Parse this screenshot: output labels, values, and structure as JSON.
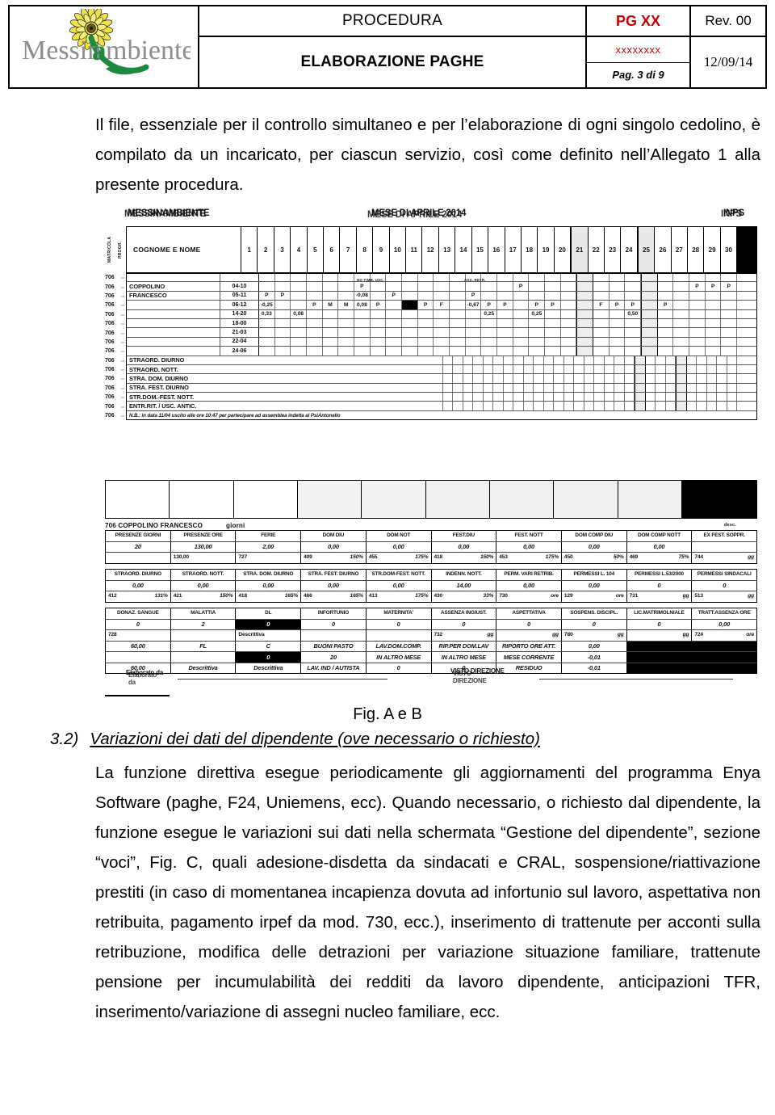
{
  "header": {
    "logo_text": "Messinambiente",
    "logo_icon": "sunflower-logo",
    "procedura_label": "PROCEDURA",
    "doc_code": "PG XX",
    "revision": "Rev. 00",
    "doc_title": "ELABORAZIONE PAGHE",
    "doc_number": "xxxxxxxx",
    "page_label": "Pag. 3 di 9",
    "date": "12/09/14",
    "accent_color": "#cc0000"
  },
  "intro_paragraph": "Il file, essenziale per il controllo simultaneo e per l’elaborazione di ogni singolo cedolino, è compilato da un incaricato, per ciascun servizio, così come definito nell’Allegato 1 alla presente procedura.",
  "figure_caption": "Fig. A e B",
  "section": {
    "number": "3.2)",
    "title": "Variazioni dei dati del dipendente (ove necessario o richiesto)",
    "body": "La funzione direttiva esegue periodicamente gli aggiornamenti del programma Enya Software (paghe, F24, Uniemens, ecc). Quando necessario, o richiesto dal dipendente, la funzione esegue le variazioni sui dati nella schermata “Gestione del dipendente”, sezione “voci”, Fig. C, quali adesione-disdetta da sindacati e CRAL, sospensione/riattivazione prestiti (in caso di momentanea incapienza dovuta ad infortunio sul lavoro, aspettativa non retribuita, pagamento irpef da mod. 730, ecc.), inserimento di trattenute per acconti sulla retribuzione, modifica delle detrazioni per variazione situazione familiare, trattenute pensione per incumulabilità dei redditi da lavoro dipendente, anticipazioni TFR, inserimento/variazione di assegni nucleo familiare, ecc."
  },
  "scan": {
    "company": "MESSINAMBIENTE",
    "period": "MESE DI APRILE 2014",
    "institute": "INPS",
    "col_matricola": "MATRICOLA",
    "col_progr": "PROGR.",
    "name_header": "COGNOME E NOME",
    "days": [
      "1",
      "2",
      "3",
      "4",
      "5",
      "6",
      "7",
      "8",
      "9",
      "10",
      "11",
      "12",
      "13",
      "14",
      "15",
      "16",
      "17",
      "18",
      "19",
      "20",
      "21",
      "22",
      "23",
      "24",
      "25",
      "26",
      "27",
      "28",
      "29",
      "30"
    ],
    "shaded_days": [
      "21",
      "25"
    ],
    "micro_labels": [
      "NO TIMB. USC.",
      "ASS. RETR."
    ],
    "matricola": "706",
    "employee_surname": "COPPOLINO",
    "employee_firstname": "FRANCESCO",
    "shift_codes": [
      "04-10",
      "05-11",
      "06-12",
      "14-20",
      "18-00",
      "21-03",
      "22-04",
      "24-06"
    ],
    "overtime_labels": [
      "STRAORD. DIURNO",
      "STRAORD. NOTT.",
      "STRA. DOM. DIURNO",
      "STRA. FEST. DIURNO",
      "STR.DOM.-FEST. NOTT.",
      "ENTR.RIT. / USC. ANTIC."
    ],
    "note": "N.B.: in data 11/04 uscito alle ore 10:47 per partecipare ad assemblea indetta al PsiAntonello",
    "marks": {
      "row_0410": {
        "7": "P",
        "17": "P",
        "28": "P",
        "29": "P",
        "30": "P"
      },
      "row_0511": {
        "1": "P",
        "2": "P",
        "7": "-0,08",
        "9": "P",
        "14": "P"
      },
      "row_0612": {
        "1": "-0,25",
        "4": "P",
        "5": "M",
        "6": "M",
        "7": "0,08",
        "8": "P",
        "11": "P",
        "12": "F",
        "14": "-0,67",
        "15": "P",
        "16": "P",
        "18": "P",
        "19": "P",
        "22": "F",
        "23": "P",
        "24": "P",
        "26": "P"
      },
      "row_1420": {
        "1": "0,33",
        "3": "0,08",
        "15": "0,25",
        "18": "0,25",
        "24": "0,50"
      }
    },
    "summary_title": {
      "matricola_name": "706 COPPOLINO FRANCESCO",
      "giorni": "giorni",
      "desc": "desc."
    },
    "table1": {
      "headers": [
        "PRESENZE GIORNI",
        "PRESENZE ORE",
        "FERIE",
        "DOM  DIU",
        "DOM  NOT",
        "FEST.DIU",
        "FEST. NOTT",
        "DOM  COMP DIU",
        "DOM COMP NOTT",
        "EX FEST. SOPPR."
      ],
      "values": [
        "20",
        "130,00",
        "2,00",
        "0,00",
        "0,00",
        "0,00",
        "0,00",
        "0,00",
        "0,00",
        ""
      ],
      "values2": [
        "",
        "130,00",
        "727",
        "409",
        "455",
        "418",
        "453",
        "450",
        "469",
        "744"
      ],
      "codes": [
        "",
        "",
        "",
        "150%",
        "175%",
        "150%",
        "175%",
        "50%",
        "75%",
        "gg"
      ]
    },
    "table2": {
      "headers": [
        "STRAORD. DIURNO",
        "STRAORD. NOTT.",
        "STRA. DOM. DIURNO",
        "STRA. FEST. DIURNO",
        "STR.DOM-FEST. NOTT.",
        "INDENN. NOTT.",
        "PERM. VARI RETRIB.",
        "PERMESSI  L. 104",
        "PERMESSI L.53/2000",
        "PERMESSI SINDACALI"
      ],
      "values": [
        "0,00",
        "0,00",
        "0,00",
        "0,00",
        "0,00",
        "14,00",
        "0,00",
        "0,00",
        "0",
        "0"
      ],
      "codes_num": [
        "412",
        "421",
        "418",
        "466",
        "413",
        "430",
        "730",
        "129",
        "731",
        "513"
      ],
      "codes_unit": [
        "131%",
        "150%",
        "165%",
        "165%",
        "175%",
        "33%",
        "ore",
        "ore",
        "gg",
        "gg"
      ]
    },
    "table3": {
      "headers": [
        "DONAZ. SANGUE",
        "MALATTIA",
        "DL",
        "INFORTUNIO",
        "MATERNITA'",
        "ASSENZA INGIUST.",
        "ASPETTATIVA",
        "SOSPENS. DISCIPL.",
        "LIC.MATRIMOLNIALE",
        "TRATT.ASSENZA ORE"
      ],
      "values": [
        "0",
        "2",
        "0",
        "0",
        "0",
        "0",
        "0",
        "0",
        "0",
        "0,00"
      ],
      "codes_num": [
        "728",
        "",
        "Descrittiva",
        "",
        "",
        "732",
        "",
        "780",
        "",
        "724"
      ],
      "codes_unit": [
        "",
        "",
        "",
        "",
        "",
        "gg",
        "gg",
        "gg",
        "gg",
        "ore"
      ],
      "row4": [
        "60,00",
        "FL",
        "C",
        "BUONI PASTO",
        "LAV.DOM.COMP.",
        "RIP.PER DOM.LAV",
        "RIPORTO ORE ATT.",
        "0,00",
        "",
        ""
      ],
      "row5": [
        "",
        "",
        "0",
        "20",
        "IN ALTRO MESE",
        "IN ALTRO MESE",
        "MESE CORRENTE",
        "-0,01",
        "",
        ""
      ],
      "row6": [
        "60,00",
        "Descrittiva",
        "Descrittiva",
        "LAV. IND / AUTISTA",
        "0",
        "0",
        "RESIDUO",
        "-0,01",
        "",
        ""
      ]
    },
    "signature_left": "Elaborato da",
    "signature_right": "VISTO DIREZIONE"
  }
}
